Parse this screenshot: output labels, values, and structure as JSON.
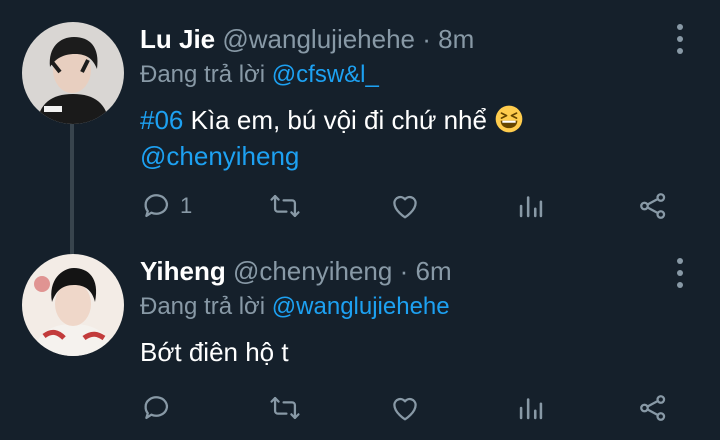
{
  "tweets": [
    {
      "display_name": "Lu Jie",
      "handle": "@wanglujiehehe",
      "separator": "·",
      "time": "8m",
      "replying_prefix": "Đang trả lời",
      "replying_to": "@cfsw&l_",
      "hashtag": "#06",
      "text": " Kìa em, bú vội đi chứ nhể ",
      "emoji": "grinning-squinting-face",
      "mention": "@chenyiheng",
      "reply_count": "1",
      "avatar": "profile-photo-lu-jie"
    },
    {
      "display_name": "Yiheng",
      "handle": "@chenyiheng",
      "separator": "·",
      "time": "6m",
      "replying_prefix": "Đang trả lời",
      "replying_to": "@wanglujiehehe",
      "text": "Bớt điên hộ t",
      "reply_count": "",
      "avatar": "profile-photo-yiheng"
    }
  ],
  "colors": {
    "background": "#15202b",
    "link": "#1da1f2",
    "muted": "#8899a6",
    "thread_line": "#38444d"
  },
  "icons": [
    "reply-icon",
    "retweet-icon",
    "like-icon",
    "analytics-icon",
    "share-icon",
    "more-icon"
  ]
}
